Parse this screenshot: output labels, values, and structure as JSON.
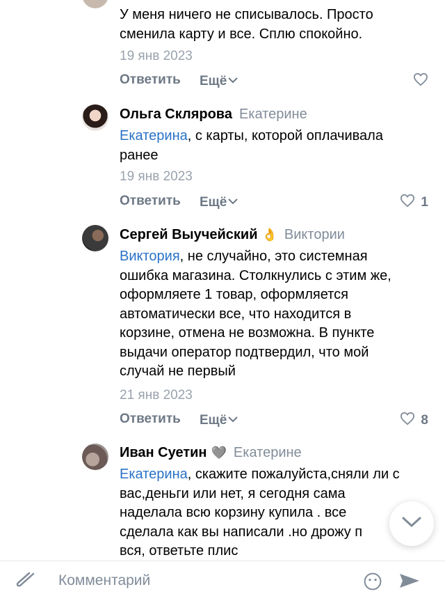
{
  "comments": [
    {
      "text": "У меня ничего не списывалось. Просто\nсменила карту и все. Сплю спокойно.",
      "date": "19 янв 2023",
      "reply_label": "Ответить",
      "more_label": "Ещё",
      "likes": ""
    },
    {
      "author": "Ольга Склярова",
      "reply_to": "Екатерине",
      "mention": "Екатерина",
      "text": ", с карты, которой оплачивала\nранее",
      "date": "19 янв 2023",
      "reply_label": "Ответить",
      "more_label": "Ещё",
      "likes": "1"
    },
    {
      "author": "Сергей Выучейский",
      "author_emoji": "👌",
      "reply_to": "Виктории",
      "mention": "Виктория",
      "text": ", не случайно, это системная\nошибка магазина. Столкнулись с этим же,\nоформляете 1 товар, оформляется\nавтоматически все, что находится в\nкорзине, отмена не возможна. В пункте\nвыдачи оператор подтвердил, что мой\nслучай не первый",
      "date": "21 янв 2023",
      "reply_label": "Ответить",
      "more_label": "Ещё",
      "likes": "8"
    },
    {
      "author": "Иван Суетин",
      "author_emoji": "🩶",
      "reply_to": "Екатерине",
      "mention": "Екатерина",
      "text": ", скажите пожалуйста,сняли ли с\nвас,деньги или нет, я сегодня сама\nнаделала всю корзину купила . все\nсделала как вы написали .но дрожу п\nвся, ответьте плис"
    }
  ],
  "composer": {
    "placeholder": "Комментарий"
  },
  "colors": {
    "mention": "#2a72c7",
    "secondary": "#818c99",
    "action": "#6d7885"
  },
  "icons": [
    "heart-icon",
    "chevron-down-icon",
    "paperclip-icon",
    "smile-icon",
    "send-icon"
  ]
}
